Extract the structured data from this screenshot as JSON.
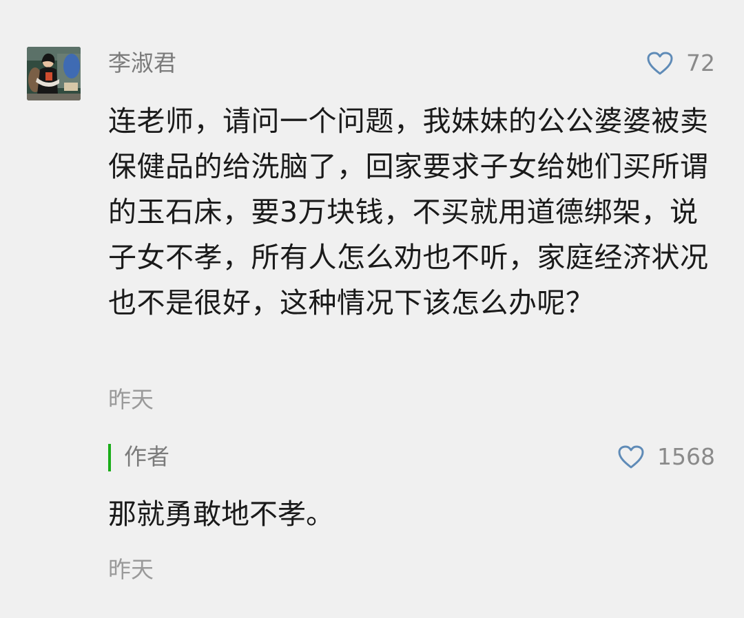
{
  "comment": {
    "username": "李淑君",
    "avatar_icon": "user-avatar-photo",
    "likes": "72",
    "text": "连老师，请问一个问题，我妹妹的公公婆婆被卖保健品的给洗脑了，回家要求子女给她们买所谓的玉石床，要3万块钱，不买就用道德绑架，说子女不孝，所有人怎么劝也不听，家庭经济状况也不是很好，这种情况下该怎么办呢？",
    "time": "昨天"
  },
  "reply": {
    "author_label": "作者",
    "likes": "1568",
    "text": "那就勇敢地不孝。",
    "time": "昨天",
    "accent_color": "#1aad19"
  },
  "icons": {
    "like_icon": "heart-outline-icon",
    "like_color": "#5f8bb7"
  }
}
